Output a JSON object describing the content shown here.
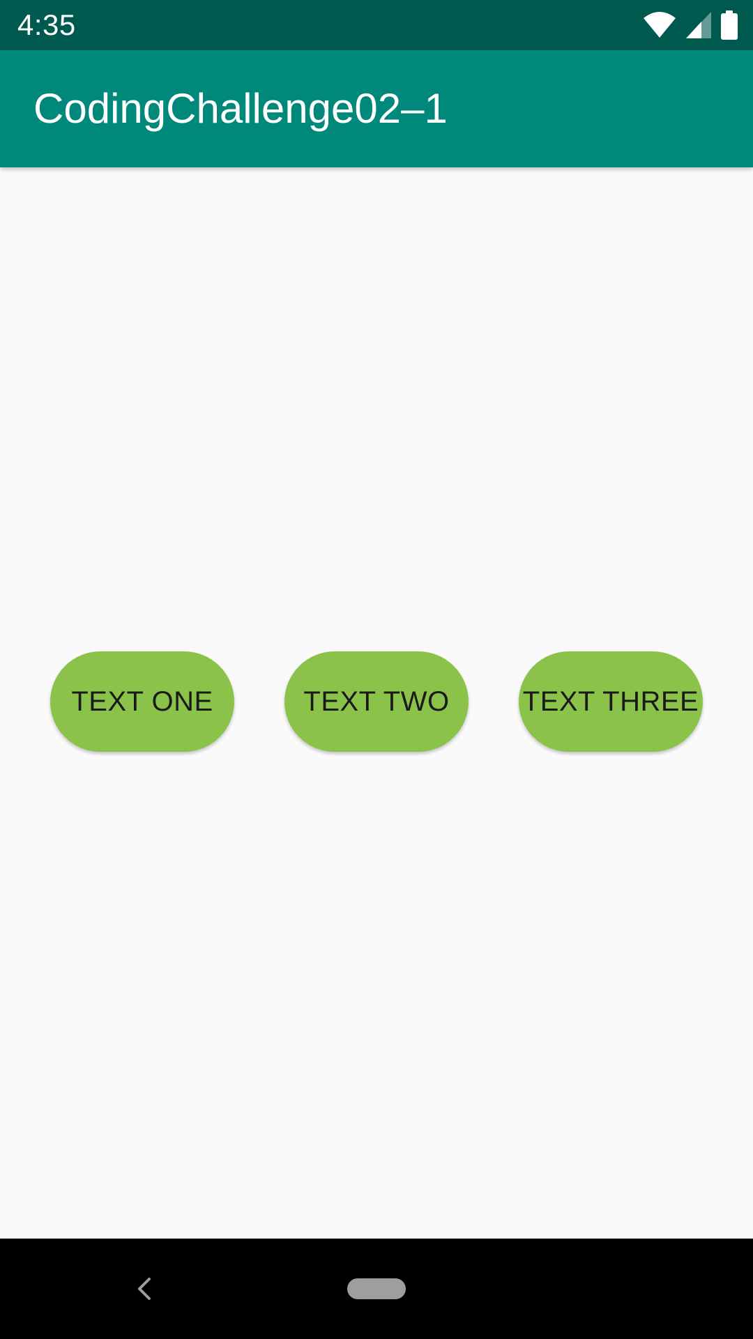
{
  "status_bar": {
    "time": "4:35",
    "icons": [
      "wifi-icon",
      "cell-signal-icon",
      "battery-icon"
    ],
    "color": "#00594f"
  },
  "app_bar": {
    "title": "CodingChallenge02–1",
    "color": "#00897b"
  },
  "buttons": [
    {
      "label": "TEXT ONE",
      "color": "#8bc34a"
    },
    {
      "label": "TEXT TWO",
      "color": "#8bc34a"
    },
    {
      "label": "TEXT THREE",
      "color": "#8bc34a"
    }
  ],
  "nav_bar": {
    "icons": [
      "back-icon",
      "home-pill-icon"
    ]
  }
}
